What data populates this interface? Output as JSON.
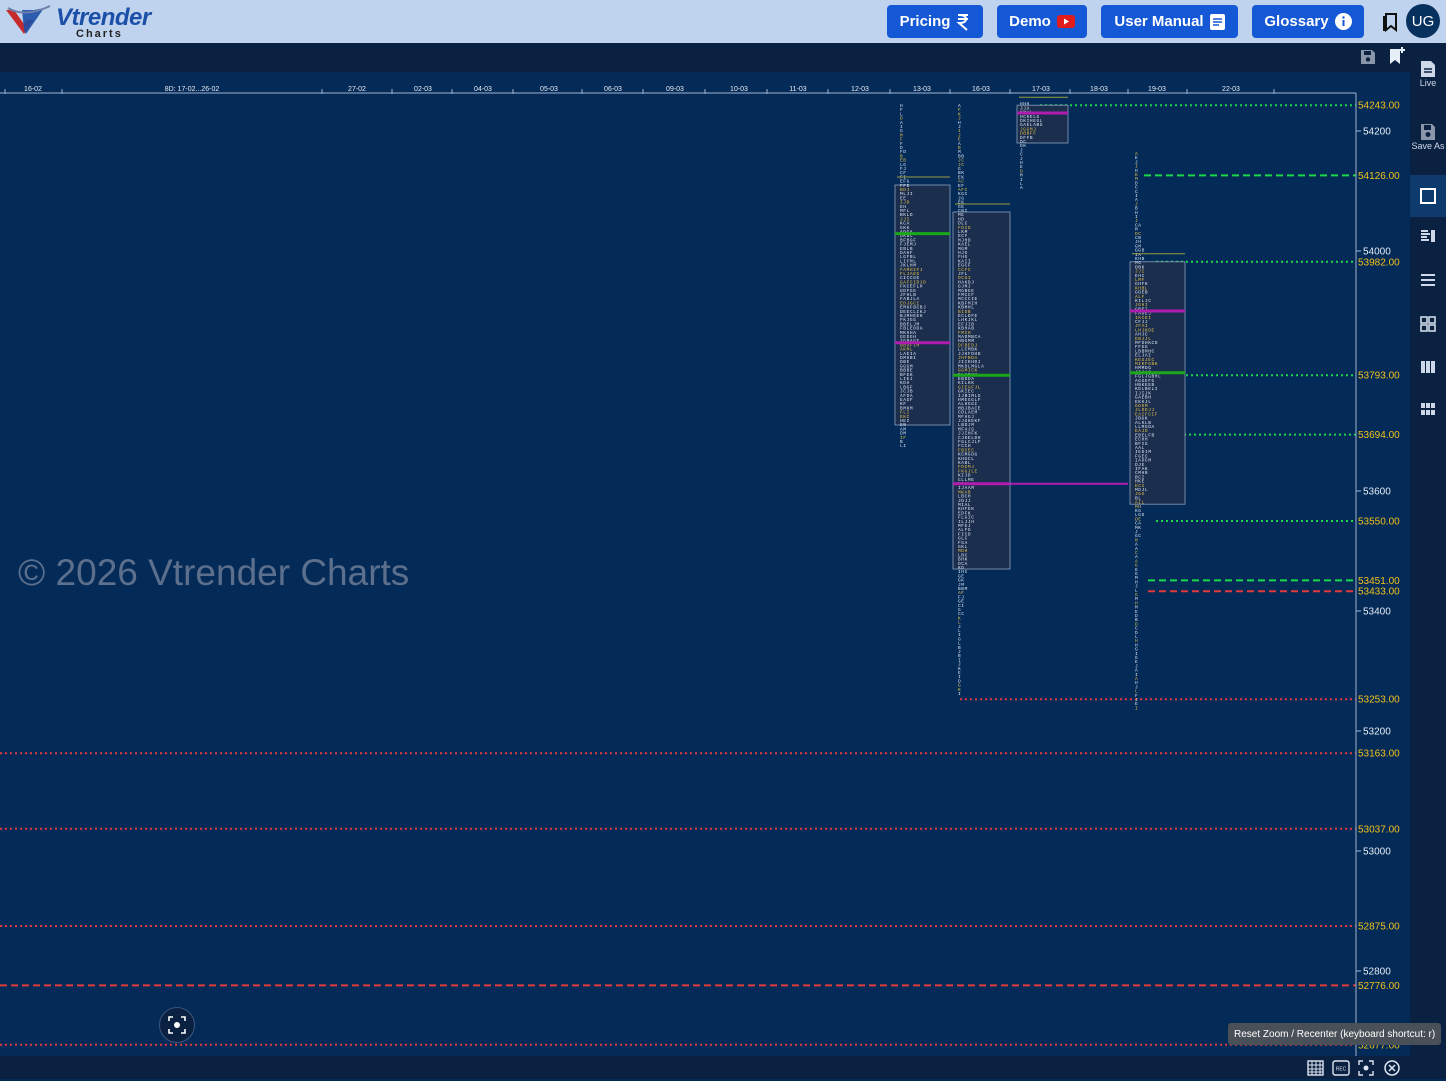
{
  "brand": {
    "name": "Vtrender",
    "sub": "Charts"
  },
  "nav": {
    "pricing": "Pricing",
    "demo": "Demo",
    "manual": "User Manual",
    "glossary": "Glossary",
    "avatar": "UG"
  },
  "panel": {
    "live": "Live",
    "save": "Save As"
  },
  "watermark": "© 2026 Vtrender Charts",
  "tooltip": "Reset Zoom / Recenter (keyboard shortcut: r)",
  "colors": {
    "background": "#042a57",
    "topbar": "#bfd3ef",
    "button": "#1558d6",
    "level_green": "#19d94a",
    "level_red": "#e03a3a",
    "price_label": "#f2c21b",
    "poc": "#b01bb0",
    "va_green": "#1aa81a"
  },
  "chart_data": {
    "type": "market-profile",
    "dates": [
      "16-02",
      "8D: 17-02...26-02",
      "27-02",
      "02-03",
      "04-03",
      "05-03",
      "06-03",
      "09-03",
      "10-03",
      "11-03",
      "12-03",
      "13-03",
      "16-03",
      "17-03",
      "18-03",
      "19-03",
      "22-03"
    ],
    "y_ticks": [
      54200,
      54000,
      53600,
      53400,
      53200,
      53000,
      52800
    ],
    "levels": [
      {
        "price": "54243.00",
        "color": "green",
        "style": "dotted"
      },
      {
        "price": "54126.00",
        "color": "green",
        "style": "dashed"
      },
      {
        "price": "53982.00",
        "color": "green",
        "style": "dotted"
      },
      {
        "price": "53793.00",
        "color": "green",
        "style": "dotted"
      },
      {
        "price": "53694.00",
        "color": "green",
        "style": "dotted"
      },
      {
        "price": "53550.00",
        "color": "green",
        "style": "dotted"
      },
      {
        "price": "53451.00",
        "color": "green",
        "style": "dashed"
      },
      {
        "price": "53433.00",
        "color": "red",
        "style": "dashed"
      },
      {
        "price": "53253.00",
        "color": "red",
        "style": "dotted"
      },
      {
        "price": "53163.00",
        "color": "red",
        "style": "dotted"
      },
      {
        "price": "53037.00",
        "color": "red",
        "style": "dotted"
      },
      {
        "price": "52875.00",
        "color": "red",
        "style": "dotted"
      },
      {
        "price": "52776.00",
        "color": "red",
        "style": "dashed"
      },
      {
        "price": "52677.00",
        "color": "red",
        "style": "dotted"
      }
    ],
    "profiles": [
      {
        "date": "13-03",
        "high": 54240,
        "low": 53670,
        "va_high": 54110,
        "va_low": 53710,
        "poc": 53847,
        "green": 54029
      },
      {
        "date": "16-03",
        "high": 54240,
        "low": 53253,
        "va_high": 54065,
        "va_low": 53470,
        "poc": 53612,
        "green": 53793
      },
      {
        "date": "17-03",
        "high": 54243,
        "low": 54100,
        "va_high": 54243,
        "va_low": 54180,
        "poc": 54230,
        "green": null
      },
      {
        "date": "19-03",
        "high": 54160,
        "low": 53230,
        "va_high": 53982,
        "va_low": 53578,
        "poc": 53900,
        "green": 53797
      }
    ]
  }
}
